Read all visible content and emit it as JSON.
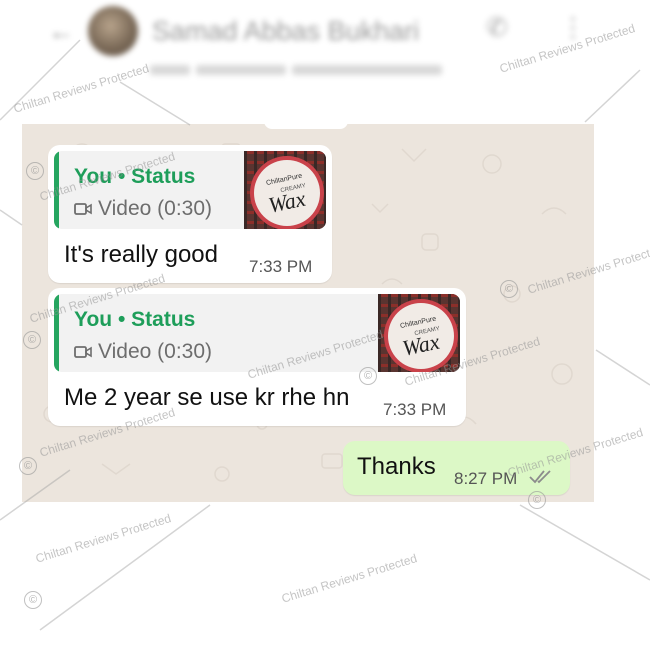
{
  "header": {
    "back_glyph": "←",
    "contact_name": "Samad Abbas Bukhari",
    "call_glyph": "✆",
    "menu_glyph": "⋮"
  },
  "messages": [
    {
      "quote_author": "You",
      "quote_separator": "•",
      "quote_label": "Status",
      "quote_media": "Video (0:30)",
      "text": "It's really good",
      "time": "7:33 PM"
    },
    {
      "quote_author": "You",
      "quote_separator": "•",
      "quote_label": "Status",
      "quote_media": "Video (0:30)",
      "text": "Me 2 year se use kr rhe hn",
      "time": "7:33 PM"
    },
    {
      "text": "Thanks",
      "time": "8:27 PM",
      "status": "read"
    }
  ],
  "product_thumbnail": {
    "brand": "ChiltanPure",
    "line": "CREAMY",
    "product": "Wax"
  },
  "watermark": {
    "text": "Chiltan Reviews Protected",
    "copyright_symbol": "©"
  },
  "colors": {
    "chat_background": "#ece5dd",
    "incoming_bubble": "#ffffff",
    "outgoing_bubble": "#dcf8c6",
    "quote_accent": "#25a55f",
    "read_ticks": "#8c8c8c"
  }
}
